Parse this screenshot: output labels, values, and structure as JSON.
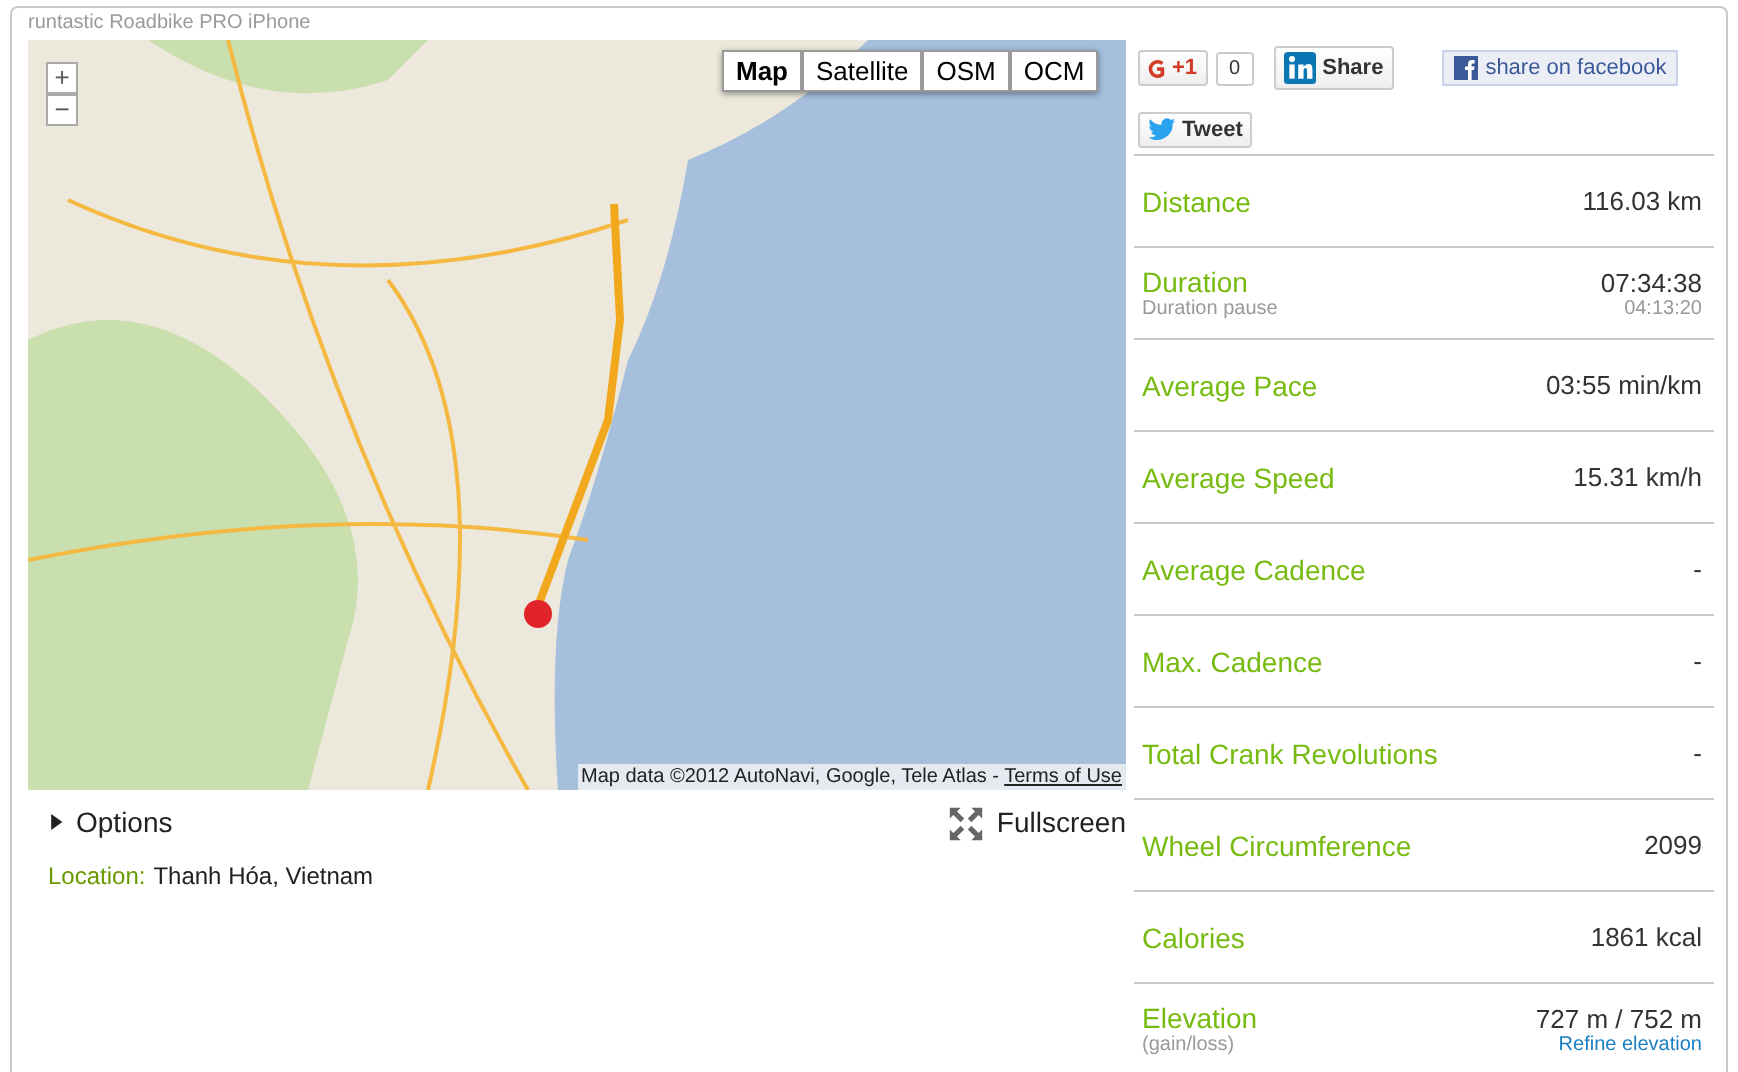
{
  "app_title": "runtastic Roadbike PRO iPhone",
  "map": {
    "zoom_controls": [
      "+",
      "−"
    ],
    "map_types": [
      {
        "label": "Map",
        "selected": true
      },
      {
        "label": "Satellite",
        "selected": false
      },
      {
        "label": "OSM",
        "selected": false
      },
      {
        "label": "OCM",
        "selected": false
      }
    ],
    "attribution": "Map data ©2012 AutoNavi, Google, Tele Atlas - ",
    "terms_link": "Terms of Use"
  },
  "options": {
    "label": "Options",
    "expanded": false
  },
  "fullscreen": "Fullscreen",
  "location": {
    "label": "Location:",
    "value": "Thanh Hóa, Vietnam"
  },
  "social": {
    "gplus_label": "+1",
    "gplus_count": "0",
    "linkedin": "Share",
    "facebook": "share on facebook",
    "twitter": "Tweet"
  },
  "stats": [
    {
      "label": "Distance",
      "value": "116.03 km"
    },
    {
      "label": "Duration",
      "sublabel": "Duration pause",
      "value": "07:34:38",
      "subvalue": "04:13:20"
    },
    {
      "label": "Average Pace",
      "value": "03:55 min/km"
    },
    {
      "label": "Average Speed",
      "value": "15.31 km/h"
    },
    {
      "label": "Average Cadence",
      "value": "-"
    },
    {
      "label": "Max. Cadence",
      "value": "-"
    },
    {
      "label": "Total Crank Revolutions",
      "value": "-"
    },
    {
      "label": "Wheel Circumference",
      "value": "2099"
    },
    {
      "label": "Calories",
      "value": "1861 kcal"
    },
    {
      "label": "Elevation",
      "sublabel": "(gain/loss)",
      "value": "727 m / 752 m",
      "link": "Refine elevation"
    }
  ]
}
